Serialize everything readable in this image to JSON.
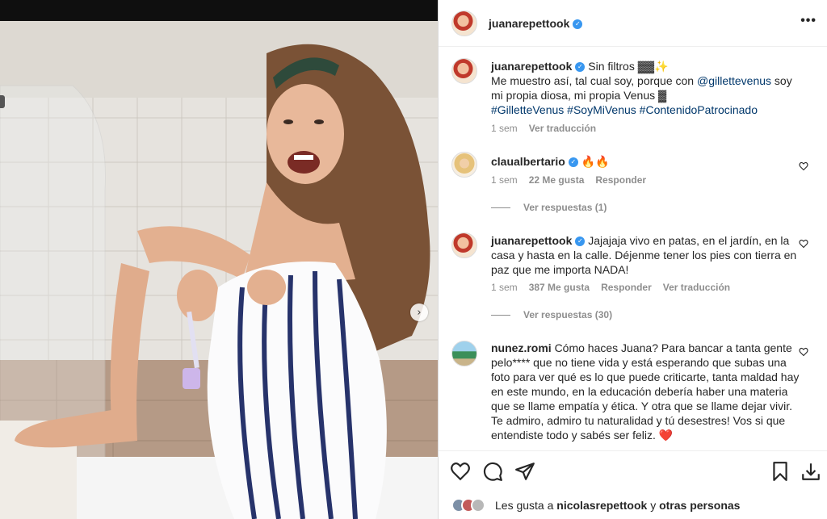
{
  "header": {
    "username": "juanarepettook",
    "more_label": "•••"
  },
  "caption": {
    "username": "juanarepettook",
    "text1": "Sin filtros ▓▓✨",
    "text2": "Me muestro así, tal cual soy, porque con",
    "mention": "@gillettevenus",
    "text3": "soy mi propia diosa, mi propia Venus ▓",
    "hashtags": "#GilletteVenus #SoyMiVenus #ContenidoPatrocinado",
    "time": "1 sem",
    "translate": "Ver traducción"
  },
  "comments": [
    {
      "username": "claualbertario",
      "text": "🔥🔥",
      "time": "1 sem",
      "likes": "22 Me gusta",
      "reply": "Responder",
      "view_replies": "Ver respuestas (1)"
    },
    {
      "username": "juanarepettook",
      "text": "Jajajaja vivo en patas, en el jardín, en la casa y hasta en la calle. Déjenme tener los pies con tierra en paz que me importa NADA!",
      "time": "1 sem",
      "likes": "387 Me gusta",
      "reply": "Responder",
      "translate": "Ver traducción",
      "view_replies": "Ver respuestas (30)"
    },
    {
      "username": "nunez.romi",
      "text": "Cómo haces Juana? Para bancar a tanta gente pelo**** que no tiene vida y está esperando que subas una foto para ver qué es lo que puede criticarte, tanta maldad hay en este mundo, en la educación debería haber una materia que se llame empatía y ética. Y otra que se llame dejar vivir. Te admiro, admiro tu naturalidad y tú desestres! Vos si que entendiste todo y sabés ser feliz. ❤️"
    }
  ],
  "likes_line": {
    "prefix": "Les gusta a",
    "user": "nicolasrepettook",
    "middle": "y",
    "suffix": "otras personas"
  },
  "icons": [
    "heart-icon",
    "comment-icon",
    "share-icon",
    "bookmark-icon",
    "download-icon",
    "chevron-right-icon",
    "verified-icon",
    "more-icon"
  ],
  "colors": {
    "link": "#00376b",
    "muted": "#8e8e8e",
    "text": "#262626",
    "verified": "#3897f0"
  }
}
